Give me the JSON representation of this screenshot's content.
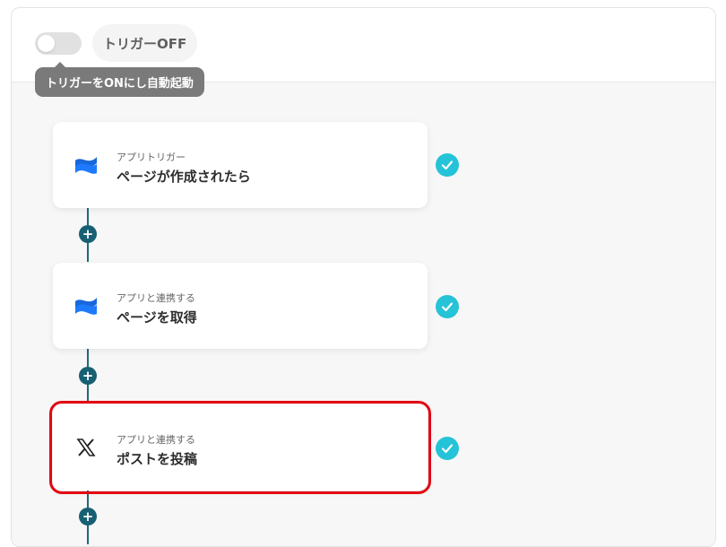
{
  "header": {
    "toggle_state": "off",
    "trigger_status_label": "トリガーOFF",
    "tooltip_text": "トリガーをONにし自動起動"
  },
  "steps": [
    {
      "subtitle": "アプリトリガー",
      "title": "ページが作成されたら",
      "icon": "confluence-icon",
      "completed": true
    },
    {
      "subtitle": "アプリと連携する",
      "title": "ページを取得",
      "icon": "confluence-icon",
      "completed": true
    },
    {
      "subtitle": "アプリと連携する",
      "title": "ポストを投稿",
      "icon": "x-logo-icon",
      "completed": true,
      "selected": true
    }
  ],
  "colors": {
    "accent_check": "#25c3d7",
    "connector": "#176073",
    "selection": "#e30613",
    "confluence_blue": "#1868db"
  }
}
